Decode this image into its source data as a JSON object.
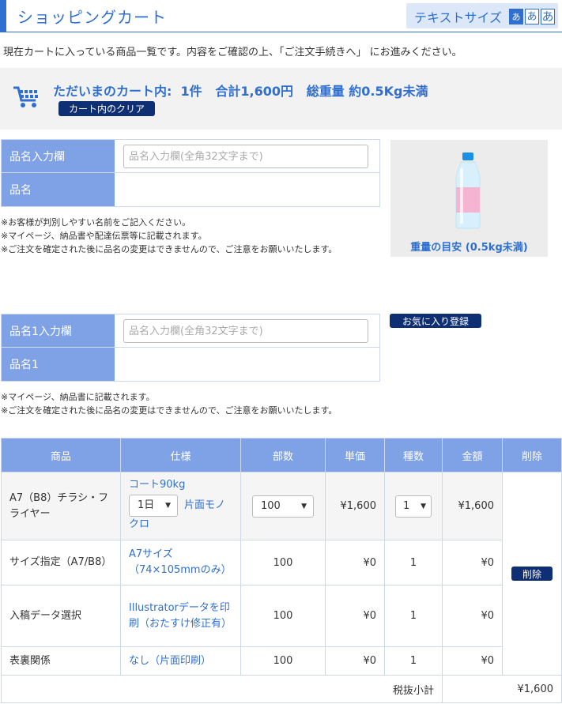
{
  "header": {
    "title": "ショッピングカート",
    "text_size_label": "テキストサイズ",
    "size_options": [
      "あ",
      "あ",
      "あ"
    ]
  },
  "intro": "現在カートに入っている商品一覧です。内容をご確認の上、「ご注文手続きへ」 にお進みください。",
  "summary": {
    "text": "ただいまのカート内:  1件   合計1,600円   総重量 約0.5Kg未満",
    "clear_label": "カート内のクリア"
  },
  "name_form": {
    "input_label": "品名入力欄",
    "placeholder": "品名入力欄(全角32文字まで)",
    "name_label": "品名",
    "notes": [
      "※お客様が判別しやすい名前をご記入ください。",
      "※マイページ、納品書や配達伝票等に記載されます。",
      "※ご注文を確定された後に品名の変更はできませんので、ご注意をお願いいたします。"
    ]
  },
  "weight": {
    "label": "重量の目安 (0.5kg未満)"
  },
  "name_form_1": {
    "input_label": "品名1入力欄",
    "placeholder": "品名入力欄(全角32文字まで)",
    "name_label": "品名1",
    "favorite_label": "お気に入り登録",
    "notes": [
      "※マイページ、納品書に記載されます。",
      "※ご注文を確定された後に品名の変更はできませんので、ご注意をお願いいたします。"
    ]
  },
  "table": {
    "headers": [
      "商品",
      "仕様",
      "部数",
      "単価",
      "種数",
      "金額",
      "削除"
    ],
    "rows": [
      {
        "product": "A7（B8）チラシ・フライヤー",
        "spec_line1": "コート90kg",
        "spec_select": "1日",
        "spec_line2a": "片面モノ",
        "spec_line2b": "クロ",
        "qty_select": "100",
        "unit_price": "¥1,600",
        "kinds_select": "1",
        "amount": "¥1,600"
      },
      {
        "product": "サイズ指定（A7/B8）",
        "spec": "A7サイズ（74×105mmのみ）",
        "qty": "100",
        "unit_price": "¥0",
        "kinds": "1",
        "amount": "¥0"
      },
      {
        "product": "入稿データ選択",
        "spec": "Illustratorデータを印刷（おたすけ修正有）",
        "qty": "100",
        "unit_price": "¥0",
        "kinds": "1",
        "amount": "¥0"
      },
      {
        "product": "表裏関係",
        "spec": "なし（片面印刷）",
        "qty": "100",
        "unit_price": "¥0",
        "kinds": "1",
        "amount": "¥0"
      }
    ],
    "delete_label": "削除",
    "subtotal_label": "税抜小計",
    "subtotal_value": "¥1,600"
  },
  "colors": {
    "accent": "#2f6fd0",
    "header_cell": "#7fa2e6",
    "button_dark": "#0f2f74"
  }
}
